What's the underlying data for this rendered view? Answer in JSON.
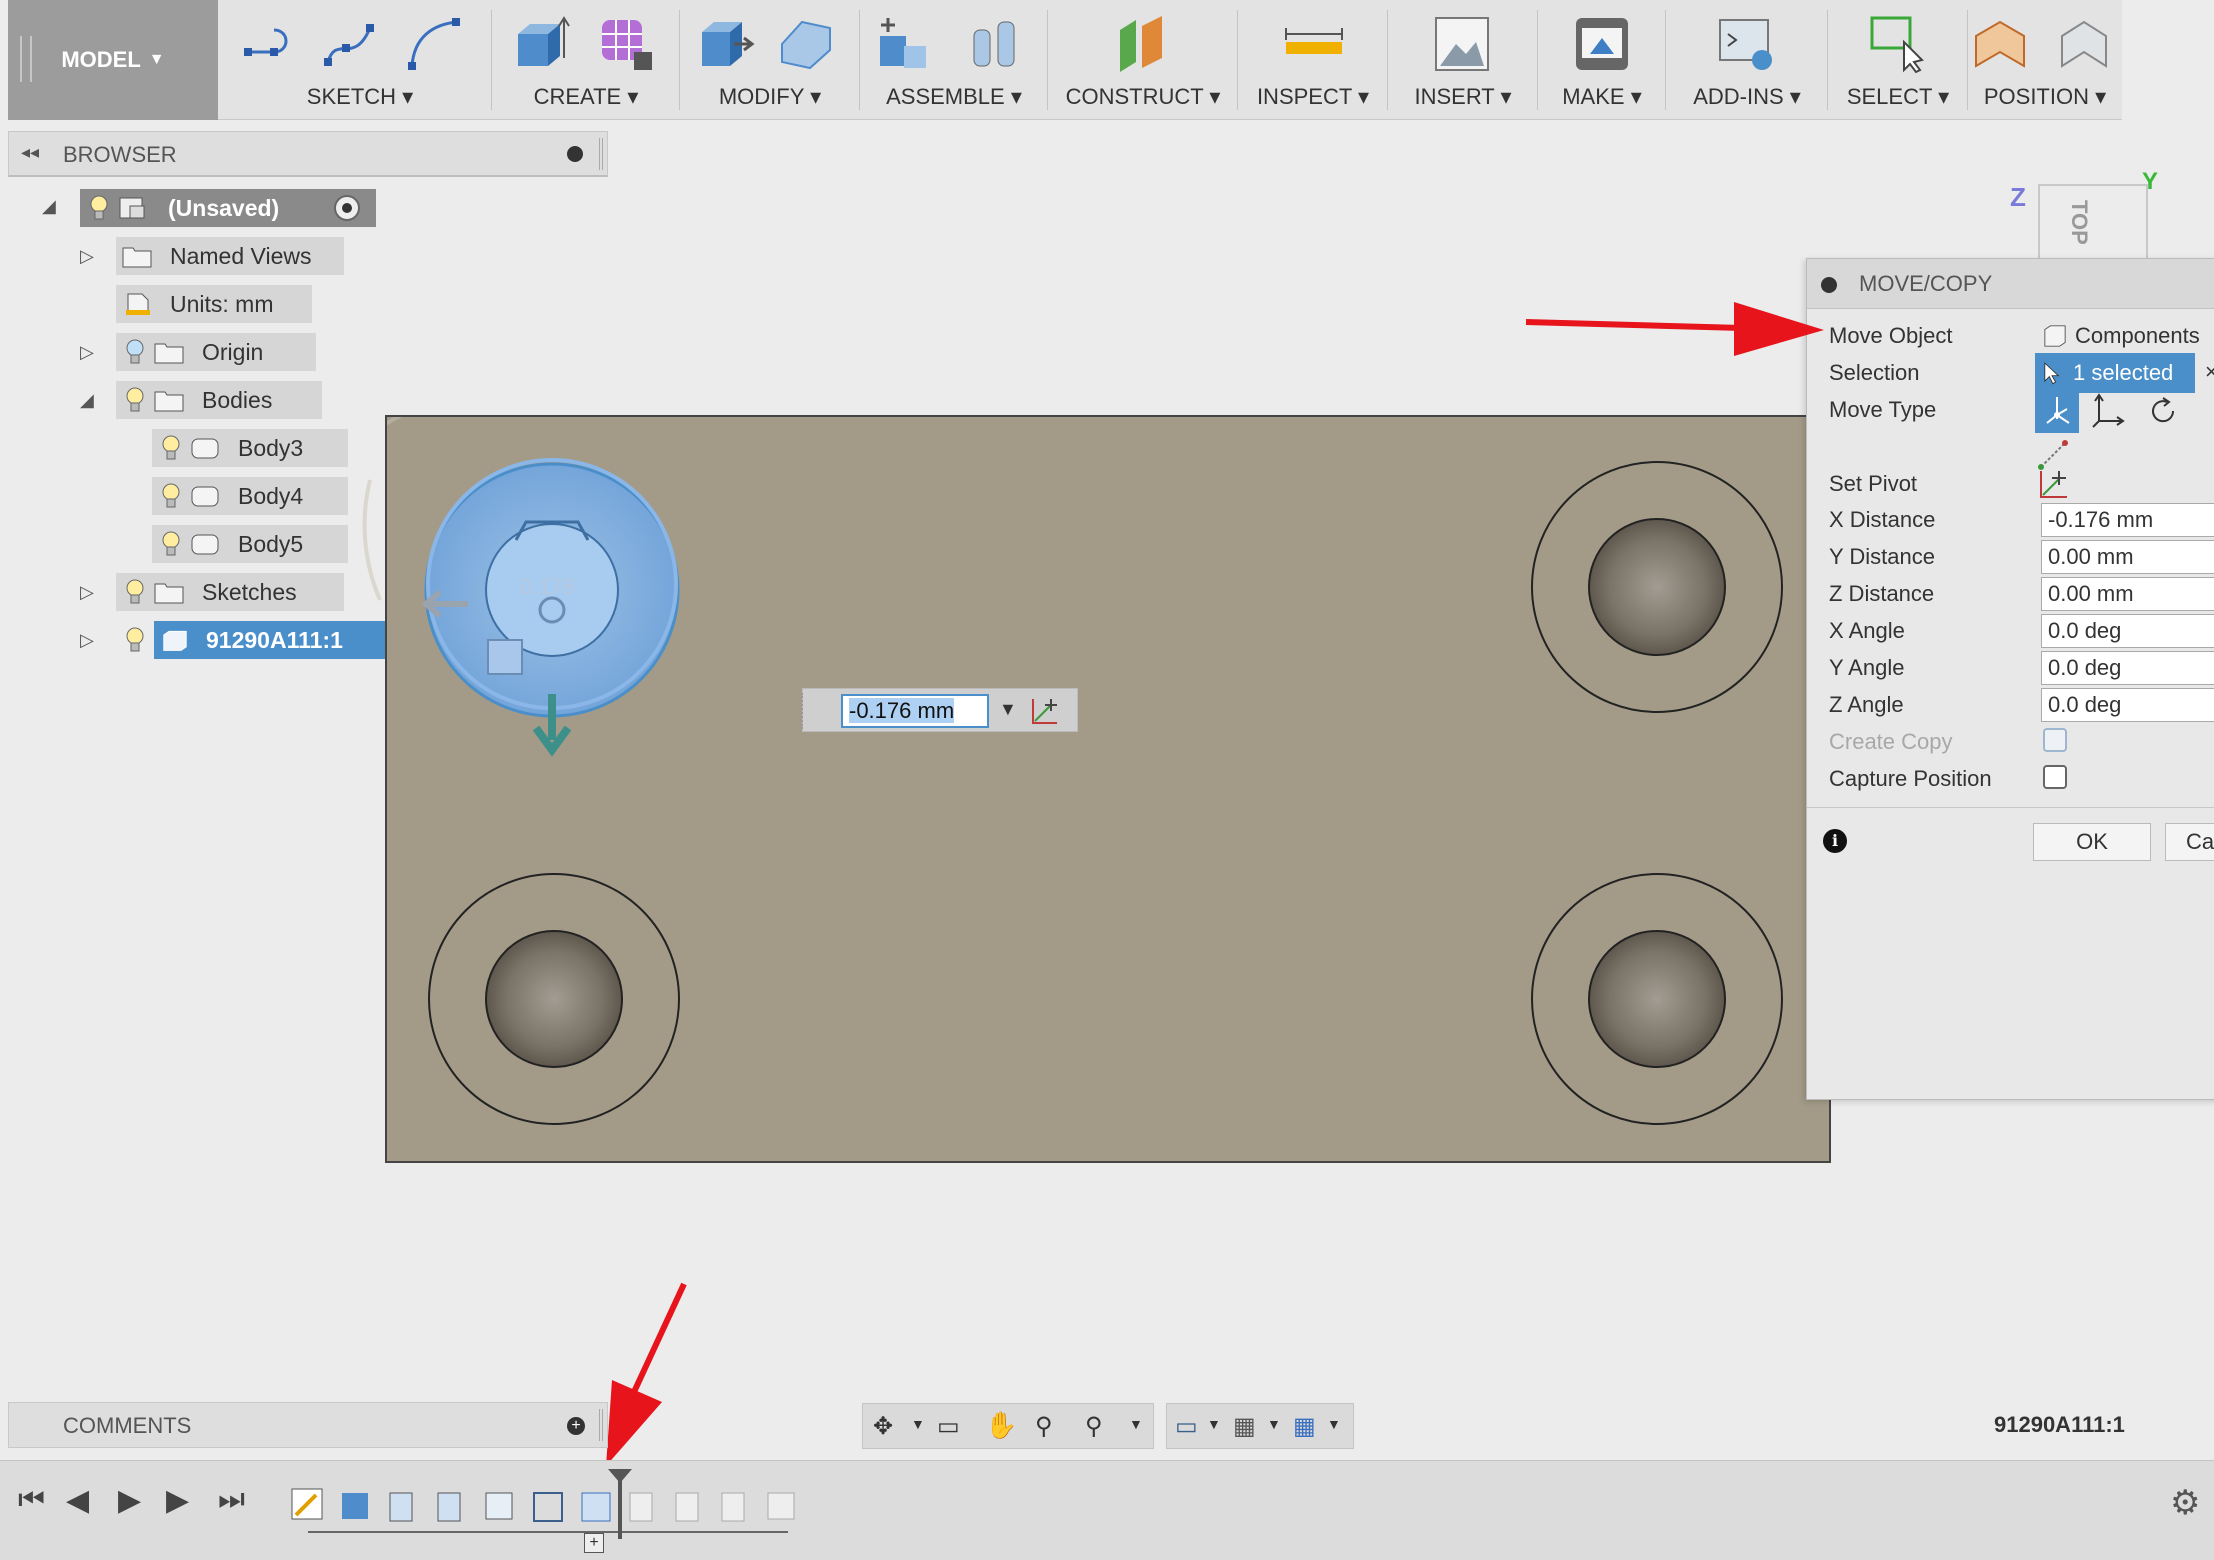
{
  "toolbar": {
    "model_label": "MODEL",
    "groups": [
      {
        "label": "SKETCH"
      },
      {
        "label": "CREATE"
      },
      {
        "label": "MODIFY"
      },
      {
        "label": "ASSEMBLE"
      },
      {
        "label": "CONSTRUCT"
      },
      {
        "label": "INSPECT"
      },
      {
        "label": "INSERT"
      },
      {
        "label": "MAKE"
      },
      {
        "label": "ADD-INS"
      },
      {
        "label": "SELECT"
      },
      {
        "label": "POSITION"
      }
    ]
  },
  "browser": {
    "title": "BROWSER",
    "root": "(Unsaved)",
    "items": [
      {
        "label": "Named Views"
      },
      {
        "label": "Units: mm"
      },
      {
        "label": "Origin"
      },
      {
        "label": "Bodies"
      },
      {
        "label": "Body3"
      },
      {
        "label": "Body4"
      },
      {
        "label": "Body5"
      },
      {
        "label": "Sketches"
      },
      {
        "label": "91290A111:1"
      }
    ]
  },
  "viewcube": {
    "z_label": "Z",
    "y_label": "Y",
    "face_label": "TOP"
  },
  "inline_input": {
    "value": "-0.176 mm",
    "manipulator_value": "0.176"
  },
  "dialog": {
    "title": "MOVE/COPY",
    "move_object_label": "Move Object",
    "move_object_value": "Components",
    "selection_label": "Selection",
    "selection_value": "1 selected",
    "move_type_label": "Move Type",
    "set_pivot_label": "Set Pivot",
    "x_distance_label": "X Distance",
    "x_distance_value": "-0.176 mm",
    "y_distance_label": "Y Distance",
    "y_distance_value": "0.00 mm",
    "z_distance_label": "Z Distance",
    "z_distance_value": "0.00 mm",
    "x_angle_label": "X Angle",
    "x_angle_value": "0.0 deg",
    "y_angle_label": "Y Angle",
    "y_angle_value": "0.0 deg",
    "z_angle_label": "Z Angle",
    "z_angle_value": "0.0 deg",
    "create_copy_label": "Create Copy",
    "capture_position_label": "Capture Position",
    "ok_label": "OK",
    "cancel_label": "Ca"
  },
  "comments": {
    "title": "COMMENTS"
  },
  "status": {
    "selected_component": "91290A111:1"
  },
  "colors": {
    "accent": "#4a8fc9",
    "annotation_arrow": "#e8141c",
    "plate": "#a39b88"
  }
}
